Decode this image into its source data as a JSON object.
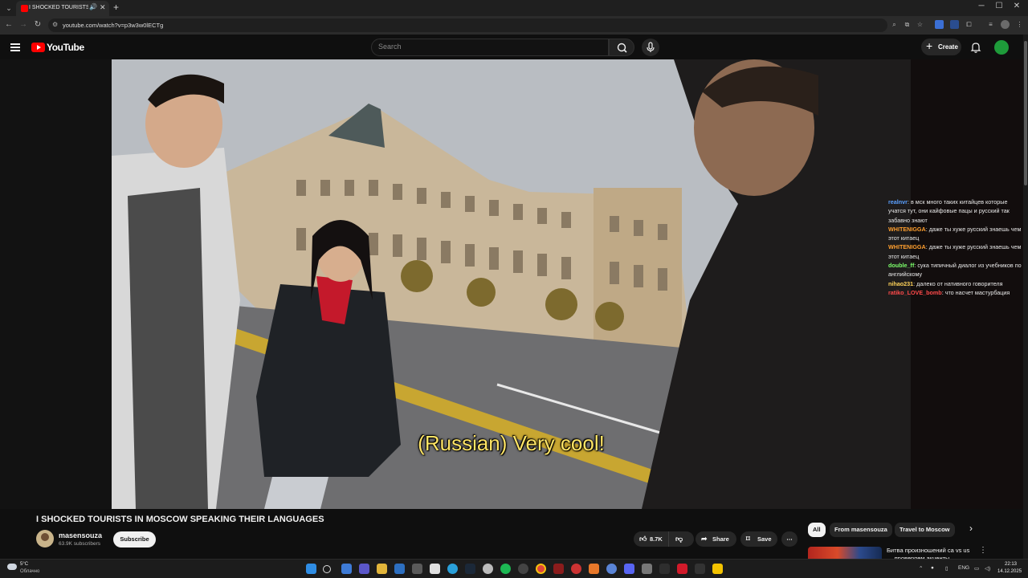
{
  "browser": {
    "tab_title": "I SHOCKED TOURISTS IN M",
    "tab_audio_icon": "speaker-icon",
    "url": "youtube.com/watch?v=p3w3w0lECTg"
  },
  "header": {
    "logo_text": "YouTube",
    "search_placeholder": "Search",
    "create_label": "Create"
  },
  "video": {
    "subtitle": "(Russian) Very cool!"
  },
  "chat": [
    {
      "user": "realnvr",
      "user_color": "#5aa0ff",
      "text": ": в мск много таких китайцев которые учатся тут, они кайфовые пацы и русский так забавно знают"
    },
    {
      "user": "WHITENIGGA",
      "user_color": "#ff9f2e",
      "text": ": даже ты хуже русский знаешь чем этот китаец"
    },
    {
      "user": "WHITENIGGA",
      "user_color": "#ff9f2e",
      "text": ": даже ты хуже русский знаешь чем этот китаец"
    },
    {
      "user": "double_ff",
      "user_color": "#7cff6b",
      "text": ": сука типичный диалог из учебников по английскому"
    },
    {
      "user": "nihao231",
      "user_color": "#ffd35a",
      "text": ": далеко от нативного говорителя"
    },
    {
      "user": "ratiko_LOVE_bomb",
      "user_color": "#ff4a4a",
      "text": ": что насчет мастурбация"
    }
  ],
  "meta": {
    "title": "I SHOCKED TOURISTS IN MOSCOW SPEAKING THEIR LANGUAGES",
    "channel_name": "masensouza",
    "subscribers": "63.9K subscribers",
    "subscribe_label": "Subscribe",
    "likes": "8.7K",
    "share_label": "Share",
    "save_label": "Save"
  },
  "chips": [
    {
      "label": "All",
      "active": true
    },
    {
      "label": "From masensouza",
      "active": false
    },
    {
      "label": "Travel to Moscow",
      "active": false
    }
  ],
  "recommendation": {
    "title": "Битва произношений ca vs us — проверяем акценты"
  },
  "taskbar": {
    "weather_temp": "5°C",
    "weather_desc": "Облачно",
    "lang": "ENG",
    "time": "22:13",
    "date": "14.12.2025"
  }
}
